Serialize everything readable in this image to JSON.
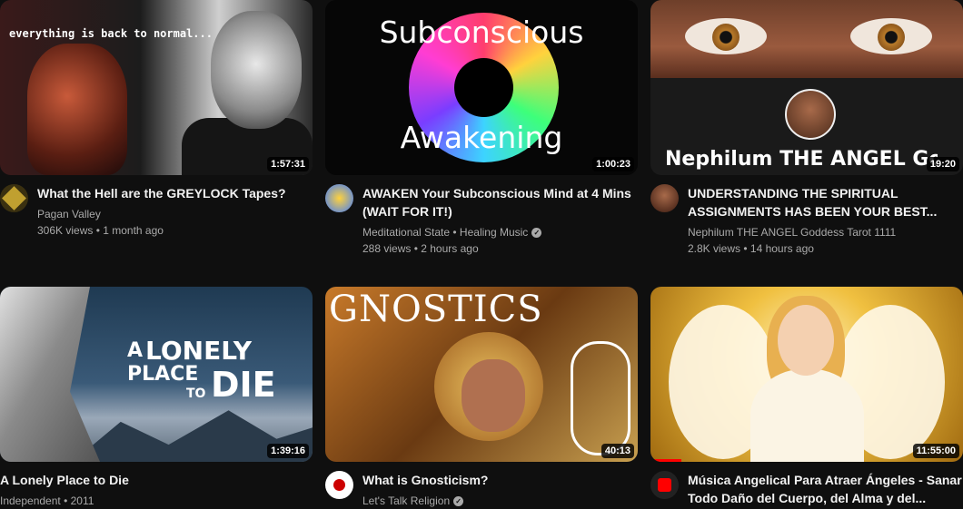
{
  "colors": {
    "background": "#0f0f0f",
    "text": "#f1f1f1",
    "muted": "#aaaaaa",
    "progress": "#ff0000"
  },
  "videos": [
    {
      "thumb_text": "everything is back to normal...",
      "duration": "1:57:31",
      "title": "What the Hell are the GREYLOCK Tapes?",
      "channel": "Pagan Valley",
      "stats": "306K views • 1 month ago",
      "verified": false
    },
    {
      "thumb_text_top": "Subconscious",
      "thumb_text_bottom": "Awakening",
      "duration": "1:00:23",
      "title": "AWAKEN Your Subconscious Mind at 4 Mins (WAIT FOR IT!)",
      "channel": "Meditational State • Healing Music",
      "stats": "288 views • 2 hours ago",
      "verified": true
    },
    {
      "thumb_text": "Nephilum THE ANGEL Goddess",
      "duration": "19:20",
      "title": "UNDERSTANDING THE SPIRITUAL ASSIGNMENTS HAS BEEN YOUR BEST...",
      "channel": "Nephilum THE ANGEL Goddess Tarot 1111",
      "stats": "2.8K views • 14 hours ago",
      "verified": false
    },
    {
      "thumb_text_a": "A",
      "thumb_text_lonely": "LONELY",
      "thumb_text_place": "PLACE",
      "thumb_text_to": "TO",
      "thumb_text_die": "DIE",
      "duration": "1:39:16",
      "title": "A Lonely Place to Die",
      "channel": "Independent • 2011",
      "verified": false
    },
    {
      "thumb_text": "GNOSTICS",
      "duration": "40:13",
      "title": "What is Gnosticism?",
      "channel": "Let's Talk Religion",
      "verified": true
    },
    {
      "duration": "11:55:00",
      "title": "Música Angelical Para Atraer Ángeles - Sanar Todo Daño del Cuerpo, del Alma y del...",
      "watched_fraction": 0.1
    }
  ]
}
